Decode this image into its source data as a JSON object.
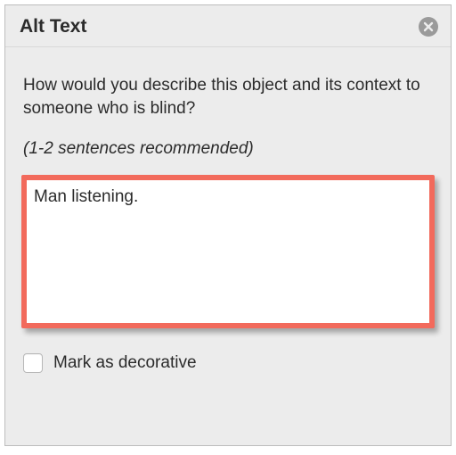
{
  "header": {
    "title": "Alt Text"
  },
  "body": {
    "prompt": "How would you describe this object and its context to someone who is blind?",
    "hint": "(1-2 sentences recommended)",
    "textarea_value": "Man listening.",
    "checkbox_label": "Mark as decorative",
    "checkbox_checked": false
  },
  "annotation": {
    "highlight_color": "#f26a5c"
  }
}
